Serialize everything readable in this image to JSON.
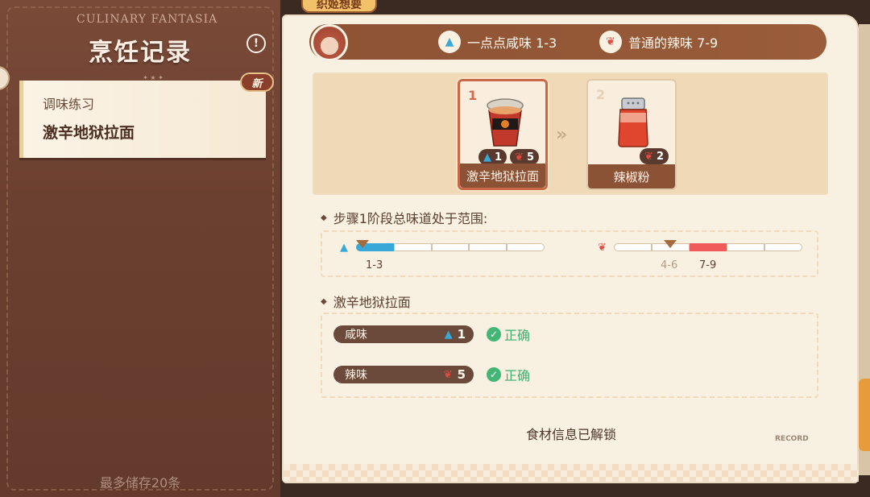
{
  "cover": {
    "eyebrow": "CULINARY FANTASIA",
    "title": "烹饪记录",
    "divider": "✦ ★ ✦",
    "storage_note": "最多储存20条"
  },
  "record": {
    "subtitle": "调味练习",
    "name": "激辛地狱拉面",
    "badge": "新"
  },
  "header": {
    "tag": "织姬想要",
    "hint_salt": "一点点咸味 1-3",
    "hint_spicy": "普通的辣味 7-9"
  },
  "ingredients": [
    {
      "number": "1",
      "label": "激辛地狱拉面",
      "salt": "1",
      "spicy": "5"
    },
    {
      "number": "2",
      "label": "辣椒粉",
      "spicy": "2"
    }
  ],
  "arrow": "»",
  "range_section": {
    "title": "步骤1阶段总味道处于范围:",
    "salt_target": "1-3",
    "salt_level": 1,
    "spicy_current": "4-6",
    "spicy_target": "7-9",
    "spicy_level": 5,
    "gauge_segments": 5
  },
  "result_section": {
    "title": "激辛地狱拉面",
    "rows": [
      {
        "label": "咸味",
        "value": "1",
        "status": "正确"
      },
      {
        "label": "辣味",
        "value": "5",
        "status": "正确"
      }
    ]
  },
  "unlock_text": "食材信息已解锁",
  "stamp": "RECORD",
  "colors": {
    "salt": "#38a8d8",
    "spicy": "#f05a5a",
    "correct": "#43b676",
    "brown": "#8b5236"
  },
  "icons": {
    "salt": "salt-shaker-icon",
    "spicy": "chili-pepper-icon",
    "info": "info-icon",
    "check": "check-circle-icon"
  }
}
